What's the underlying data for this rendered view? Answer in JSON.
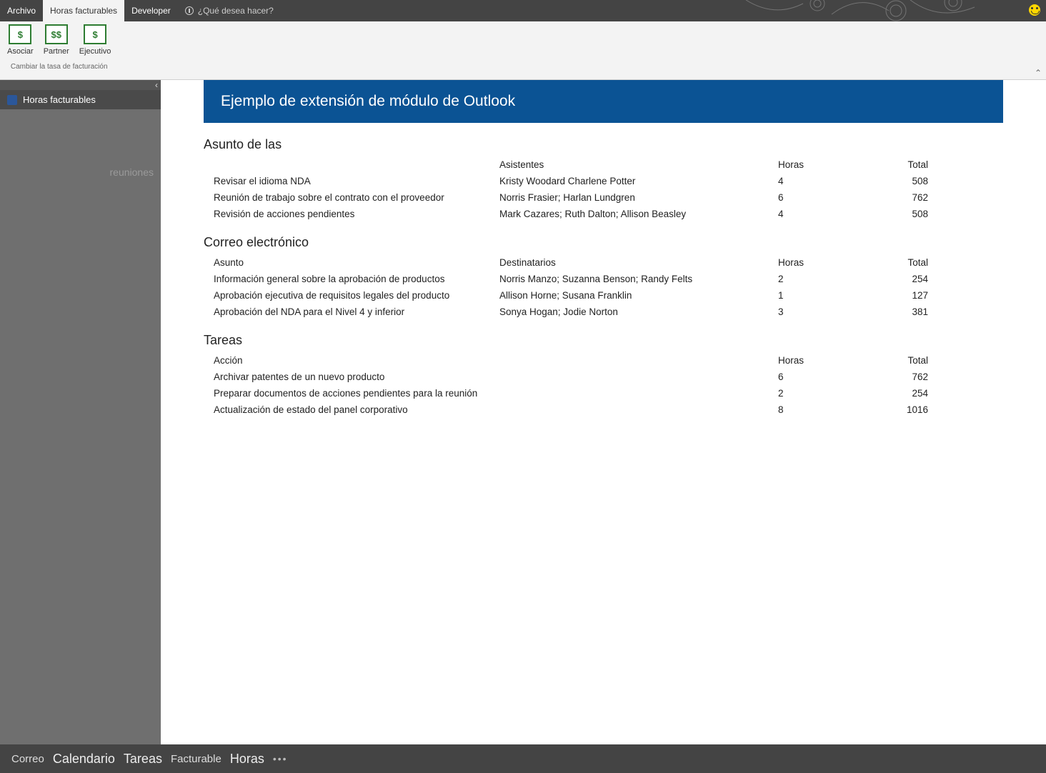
{
  "tabs": {
    "archivo": "Archivo",
    "horas": "Horas facturables",
    "developer": "Developer",
    "tellme": "¿Qué desea hacer?"
  },
  "ribbon": {
    "asociar": {
      "glyph": "$",
      "label": "Asociar"
    },
    "partner": {
      "glyph": "$$",
      "label": "Partner"
    },
    "ejecutivo": {
      "glyph": "$",
      "label": "Ejecutivo"
    },
    "group_label": "Cambiar la tasa de facturación"
  },
  "sidebar": {
    "item_label": "Horas facturables",
    "body_text": "reuniones"
  },
  "banner_title": "Ejemplo de extensión de módulo de Outlook",
  "sect1": {
    "heading": "Asunto de las",
    "hdr": {
      "c2": "Asistentes",
      "c3": "Horas",
      "c4": "Total"
    },
    "rows": [
      {
        "c1": "Revisar el idioma NDA",
        "c2": "Kristy Woodard Charlene Potter",
        "c3": "4",
        "c4": "508"
      },
      {
        "c1": "Reunión de trabajo sobre el contrato con el proveedor",
        "c2": "Norris Frasier; Harlan Lundgren",
        "c3": "6",
        "c4": "762"
      },
      {
        "c1": "Revisión de acciones pendientes",
        "c2": "Mark Cazares; Ruth Dalton; Allison Beasley",
        "c3": "4",
        "c4": "508"
      }
    ]
  },
  "sect2": {
    "heading": "Correo electrónico",
    "hdr": {
      "c1": "Asunto",
      "c2": "Destinatarios",
      "c3": "Horas",
      "c4": "Total"
    },
    "rows": [
      {
        "c1": "Información general sobre la aprobación de productos",
        "c2": "Norris Manzo; Suzanna Benson; Randy Felts",
        "c3": "2",
        "c4": "254"
      },
      {
        "c1": "Aprobación ejecutiva de requisitos legales del producto",
        "c2": "Allison Horne; Susana Franklin",
        "c3": "1",
        "c4": "127"
      },
      {
        "c1": "Aprobación del NDA para el Nivel 4 y inferior",
        "c2": "Sonya Hogan; Jodie Norton",
        "c3": "3",
        "c4": "381"
      }
    ]
  },
  "sect3": {
    "heading": "Tareas",
    "hdr": {
      "c1": "Acción",
      "c3": "Horas",
      "c4": "Total"
    },
    "rows": [
      {
        "c1": "Archivar patentes de un nuevo producto",
        "c2": "",
        "c3": "6",
        "c4": "762"
      },
      {
        "c1": "Preparar documentos de acciones pendientes para la reunión",
        "c2": "",
        "c3": "2",
        "c4": "254"
      },
      {
        "c1": "Actualización de estado del panel corporativo",
        "c2": "",
        "c3": "8",
        "c4": "1016"
      }
    ]
  },
  "bottom": {
    "correo": "Correo",
    "calendario": "Calendario",
    "tareas": "Tareas",
    "facturable": "Facturable",
    "horas": "Horas"
  }
}
